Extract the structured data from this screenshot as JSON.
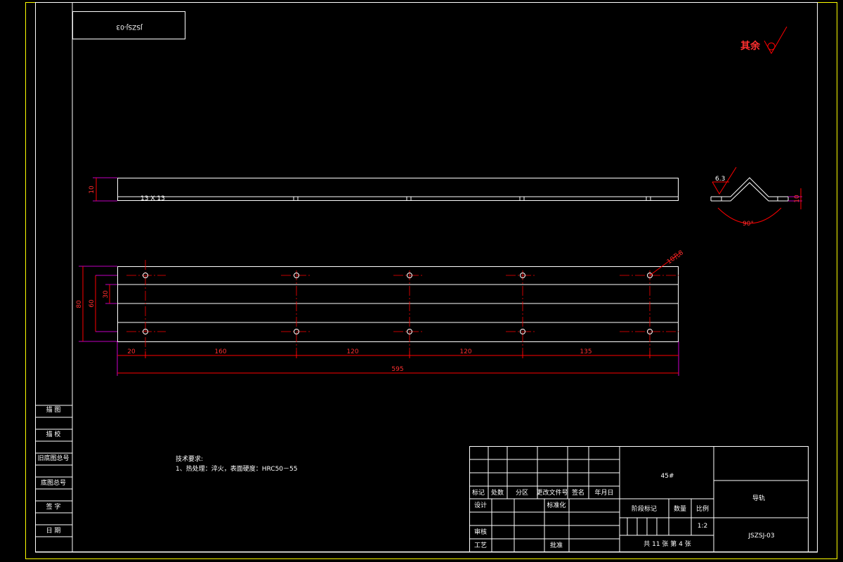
{
  "drawing": {
    "rotated_code": "JSZSJ-03",
    "surface_note": "其余",
    "surface_roughness": "6.3",
    "angle": "90°",
    "thickness_dim": "10",
    "hole_callout": "10孔8",
    "dims": {
      "height_side": "10",
      "overall_height": "80",
      "inner_height": "30",
      "h1": "20",
      "h2": "160",
      "h3": "120",
      "h4": "120",
      "h5": "135",
      "overall": "595"
    }
  },
  "left_column": {
    "rows": [
      "描 图",
      "描 校",
      "旧底图总号",
      "底图总号",
      "签 字",
      "日 期"
    ]
  },
  "tech_requirements": {
    "title": "技术要求:",
    "item1": "1、热处理：淬火，表面硬度：HRC50－55"
  },
  "title_block": {
    "material": "45#",
    "part_name": "导轨",
    "drawing_no": "JSZSJ-03",
    "headers": [
      "标记",
      "处数",
      "分区",
      "更改文件号",
      "签名",
      "年月日"
    ],
    "design": "设计",
    "standardize": "标准化",
    "review": "审核",
    "process": "工艺",
    "approve": "批准",
    "stage_mark": "阶段标记",
    "quantity": "数量",
    "scale_label": "比例",
    "scale": "1:2",
    "sheets": "共 11 张  第 4 张"
  }
}
